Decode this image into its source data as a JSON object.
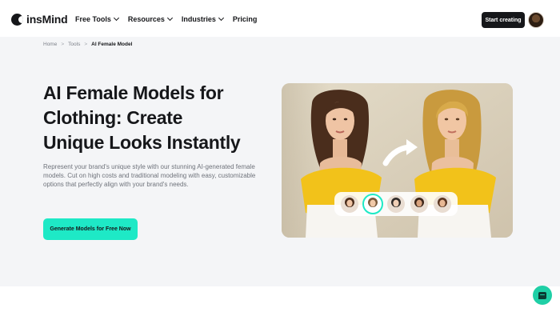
{
  "header": {
    "brand": "insMind",
    "logo_icon": "insmind-logo-icon",
    "nav": [
      {
        "label": "Free Tools",
        "has_dropdown": true
      },
      {
        "label": "Resources",
        "has_dropdown": true
      },
      {
        "label": "Industries",
        "has_dropdown": true
      },
      {
        "label": "Pricing",
        "has_dropdown": false
      }
    ],
    "cta_label": "Start creating",
    "avatar_icon": "user-avatar"
  },
  "breadcrumb": [
    "Home",
    "Tools",
    "AI Female Model"
  ],
  "hero": {
    "headline_lines": [
      "AI Female Models for",
      "Clothing: Create",
      "Unique Looks Instantly"
    ],
    "description": "Represent your brand's unique style with our stunning AI-generated female models. Cut on high costs and traditional modeling with easy, customizable options that perfectly align with your brand's needs.",
    "cta_label": "Generate Models for Free Now"
  },
  "showcase": {
    "model_thumbnails": [
      {
        "name": "model-1",
        "selected": false
      },
      {
        "name": "model-2",
        "selected": true
      },
      {
        "name": "model-3",
        "selected": false
      },
      {
        "name": "model-4",
        "selected": false
      },
      {
        "name": "model-5",
        "selected": false
      }
    ]
  },
  "chat_widget_icon": "chat-bubble-icon",
  "colors": {
    "accent": "#1EE9C6",
    "dark": "#16171A",
    "hero_bg": "#F4F5F7",
    "top_yellow": "#F2C21A",
    "skirt_white": "#F7F5F1"
  }
}
